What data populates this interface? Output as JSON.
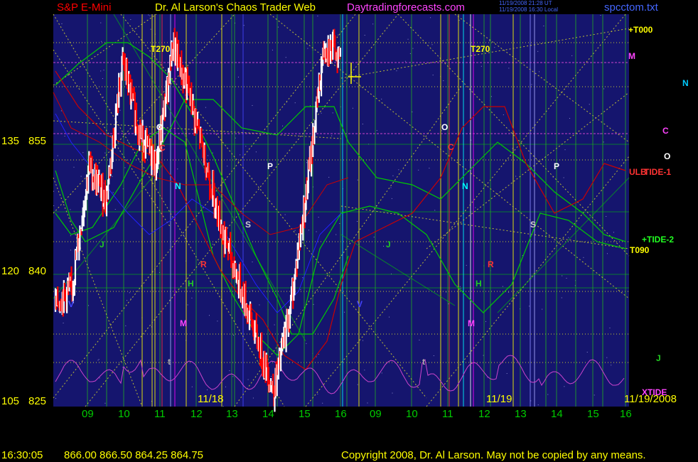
{
  "header": {
    "instrument": "S&P E-Mini",
    "title": "Dr. Al Larson's Chaos Trader Web",
    "site": "Daytradingforecasts.com",
    "stamp1": "11/19/2008 21:28 UT",
    "stamp2": "11/19/2008 16:30 Local",
    "file": "spcctom.txt"
  },
  "footer": {
    "time": "16:30:05",
    "ohlc": "866.00 866.50 864.25 864.75",
    "copyright": "Copyright 2008, Dr. Al Larson. May not be copied by any means."
  },
  "colors": {
    "background": "#000000",
    "plot_bg": "#15156e",
    "price_up": "#ffffff",
    "price_down": "#ff0000",
    "bollinger": "#00cc00",
    "red_curve": "#cc0000",
    "blue_curve": "#2222ff",
    "magenta_curve": "#cc44cc",
    "yellow_gridline": "#cccc33",
    "green_gridline": "#22aa22",
    "axis_label": "#ffff00"
  },
  "chart_data": {
    "type": "line",
    "y_axis": {
      "ticks": [
        {
          "left": "135",
          "right": "855",
          "value": 855
        },
        {
          "left": "120",
          "right": "840",
          "value": 840
        },
        {
          "left": "105",
          "right": "825",
          "value": 825
        }
      ]
    },
    "x_axis": {
      "hour_ticks": [
        "09",
        "10",
        "11",
        "12",
        "13",
        "14",
        "15",
        "16",
        "09",
        "10",
        "11",
        "12",
        "13",
        "14",
        "15",
        "16"
      ],
      "date_labels": [
        "11/18",
        "11/19",
        "11/19/2008"
      ]
    },
    "level_labels": [
      "+T000",
      "M",
      "N",
      "C",
      "O",
      "ULB",
      "TIDE-1",
      "+TIDE-2",
      "T090",
      "J",
      "XTIDE"
    ],
    "markers": [
      "T270",
      "O",
      "C",
      "N",
      "P",
      "S",
      "R",
      "H",
      "V",
      "M",
      "J",
      "t",
      "T270",
      "O",
      "C",
      "N",
      "P",
      "S",
      "R",
      "H",
      "V",
      "M",
      "J",
      "t"
    ],
    "series": [
      {
        "name": "S&P E-Mini",
        "points": [
          [
            "09",
            836
          ],
          [
            "09",
            838
          ],
          [
            "10",
            852
          ],
          [
            "10",
            848
          ],
          [
            "10",
            864
          ],
          [
            "11",
            856
          ],
          [
            "11",
            852
          ],
          [
            "12",
            866
          ],
          [
            "12",
            860
          ],
          [
            "13",
            852
          ],
          [
            "13",
            844
          ],
          [
            "14",
            838
          ],
          [
            "14",
            832
          ],
          [
            "15",
            826
          ],
          [
            "15",
            836
          ],
          [
            "16",
            850
          ],
          [
            "16",
            866
          ],
          [
            "16",
            864.75
          ]
        ]
      }
    ]
  }
}
